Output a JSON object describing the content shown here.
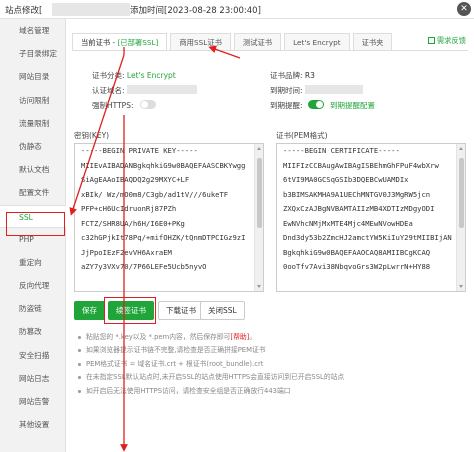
{
  "window": {
    "title_prefix": "站点修改[",
    "title_time": "添加时间[2023-08-28 23:00:40]",
    "close_icon": "close-icon"
  },
  "sidebar": {
    "items": [
      {
        "label": "域名管理"
      },
      {
        "label": "子目录绑定"
      },
      {
        "label": "网站目录"
      },
      {
        "label": "访问限制"
      },
      {
        "label": "流量限制"
      },
      {
        "label": "伪静态"
      },
      {
        "label": "默认文档"
      },
      {
        "label": "配置文件"
      },
      {
        "label": "SSL"
      },
      {
        "label": "PHP"
      },
      {
        "label": "重定向"
      },
      {
        "label": "反向代理"
      },
      {
        "label": "防盗链"
      },
      {
        "label": "防篡改"
      },
      {
        "label": "安全扫描"
      },
      {
        "label": "网站日志"
      },
      {
        "label": "网站告警"
      },
      {
        "label": "其他设置"
      }
    ]
  },
  "tabs": {
    "current_prefix": "当前证书 - ",
    "current_status": "[已部署SSL]",
    "items": [
      {
        "label": "商用SSL证书"
      },
      {
        "label": "测试证书"
      },
      {
        "label": "Let's Encrypt"
      },
      {
        "label": "证书夹"
      }
    ],
    "help_label": "需求反馈"
  },
  "cert_info": {
    "category_label": "证书分类:",
    "category_value": "Let's Encrypt",
    "domain_label": "认证域名:",
    "force_https_label": "强制HTTPS:",
    "force_https_on": false,
    "brand_label": "证书品牌:",
    "brand_value": "R3",
    "expire_label": "到期时间:",
    "remind_label": "到期提醒:",
    "remind_on": true,
    "remind_link": "到期提醒配置"
  },
  "key_box": {
    "label": "密钥(KEY)",
    "lines": [
      "-----BEGIN PRIVATE KEY-----",
      "MIIEvAIBADANBgkqhkiG9w0BAQEFAASCBKYwgg",
      "SiAgEAAoIBAQDQ2g29MXYC+LF",
      "xBIk/ Wz/mO0m8/C3gb/ad1tV///6ukeTF",
      "PFP+cH6UcIdruonRj87PZh",
      "FCTZ/SHR8UA/h6H/I6E0+PKg",
      "c32hGPjkIt78Pq/+mifOHZK/tQnmDTPCIGz9zI",
      "JjPpoIEzF2evVH6AxraEM",
      "aZY7y3VXv70/7P66LEFe5Ucb5nyvO"
    ]
  },
  "pem_box": {
    "label": "证书(PEM格式)",
    "lines": [
      "-----BEGIN CERTIFICATE-----",
      "MIIFIzCCBAugAwIBAgISBEhmGhFPuF4wbXrw",
      "6tVI9MA0GCSqGSIb3DQEBCwUAMDIx",
      "b3BIMSAKMHA9A1UEChMNTGV0J3MgRW5jcn",
      "ZXQxCzAJBgNVBAMTAIIzMB4XDTIzMDgyODI",
      "EwNVhcNMjMxMTE4Mjc4MEwNVowHDEa",
      "Dnd3dy53b2ZmcHJ2amctYW5KiIuY29tMIIBIjAN",
      "BgkqhkiG9w0BAQEFAAOCAQ8AMIIBCgKCAQ",
      "0ooTfv7Avi38NbqvoGrs3W2pLwrrN+HY88"
    ]
  },
  "buttons": {
    "save": "保存",
    "renew": "续签证书",
    "download": "下载证书",
    "close_ssl": "关闭SSL"
  },
  "tips": [
    {
      "text": "粘贴您的 *.key以及 *.pem内容，然后保存即可",
      "link": "[帮助]",
      "suffix": "。"
    },
    {
      "text": "如果浏览器提示证书链不完整,请检查是否正确拼接PEM证书"
    },
    {
      "text": "PEM格式证书 = 域名证书.crt + 根证书(root_bundle).crt"
    },
    {
      "text": "在未指定SSL默认站点时,未开启SSL的站点使用HTTPS会直接访问到已开启SSL的站点"
    },
    {
      "text": "如开启后无法使用HTTPS访问，请检查安全组是否正确放行443端口"
    }
  ],
  "colors": {
    "accent": "#20a53a",
    "annotation": "#e02020",
    "sidebar_bg": "#f2f2f2",
    "link_red": "#e02020"
  }
}
